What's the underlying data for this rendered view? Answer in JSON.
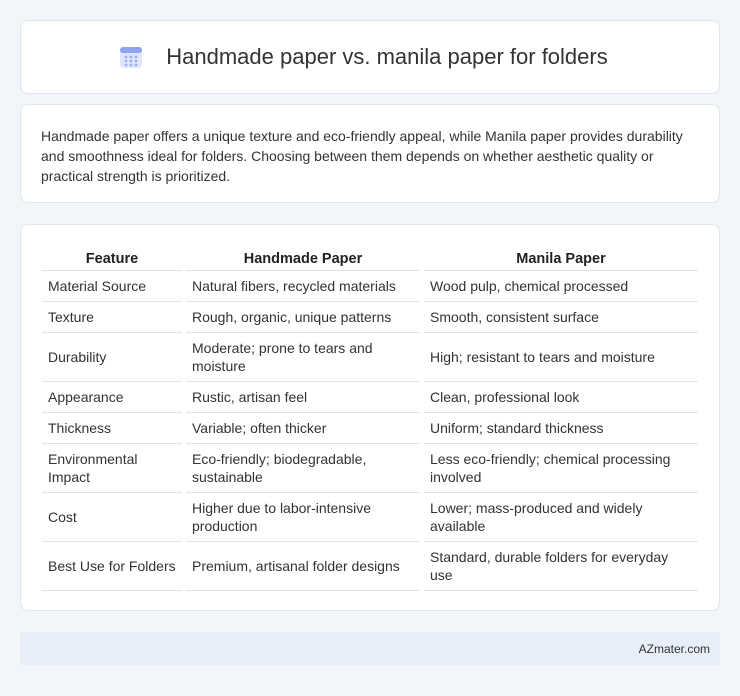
{
  "header": {
    "title": "Handmade paper vs. manila paper for folders",
    "icon": "calendar-icon",
    "icon_color": "#8fa4f0"
  },
  "intro": {
    "text": "Handmade paper offers a unique texture and eco-friendly appeal, while Manila paper provides durability and smoothness ideal for folders. Choosing between them depends on whether aesthetic quality or practical strength is prioritized."
  },
  "table": {
    "columns": [
      "Feature",
      "Handmade Paper",
      "Manila Paper"
    ],
    "rows": [
      [
        "Material Source",
        "Natural fibers, recycled materials",
        "Wood pulp, chemical processed"
      ],
      [
        "Texture",
        "Rough, organic, unique patterns",
        "Smooth, consistent surface"
      ],
      [
        "Durability",
        "Moderate; prone to tears and moisture",
        "High; resistant to tears and moisture"
      ],
      [
        "Appearance",
        "Rustic, artisan feel",
        "Clean, professional look"
      ],
      [
        "Thickness",
        "Variable; often thicker",
        "Uniform; standard thickness"
      ],
      [
        "Environmental Impact",
        "Eco-friendly; biodegradable, sustainable",
        "Less eco-friendly; chemical processing involved"
      ],
      [
        "Cost",
        "Higher due to labor-intensive production",
        "Lower; mass-produced and widely available"
      ],
      [
        "Best Use for Folders",
        "Premium, artisanal folder designs",
        "Standard, durable folders for everyday use"
      ]
    ]
  },
  "footer": {
    "text": "AZmater.com"
  }
}
